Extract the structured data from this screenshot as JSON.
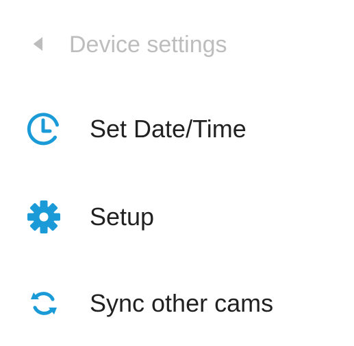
{
  "header": {
    "title": "Device settings",
    "back_icon": "back-triangle-icon"
  },
  "menu": {
    "items": [
      {
        "label": "Set Date/Time",
        "icon": "clock-icon"
      },
      {
        "label": "Setup",
        "icon": "gear-icon"
      },
      {
        "label": "Sync other cams",
        "icon": "sync-icon"
      }
    ]
  },
  "colors": {
    "accent": "#1a9bd7",
    "header_text": "#bdbdbd",
    "item_text": "#212121",
    "background": "#ffffff"
  }
}
